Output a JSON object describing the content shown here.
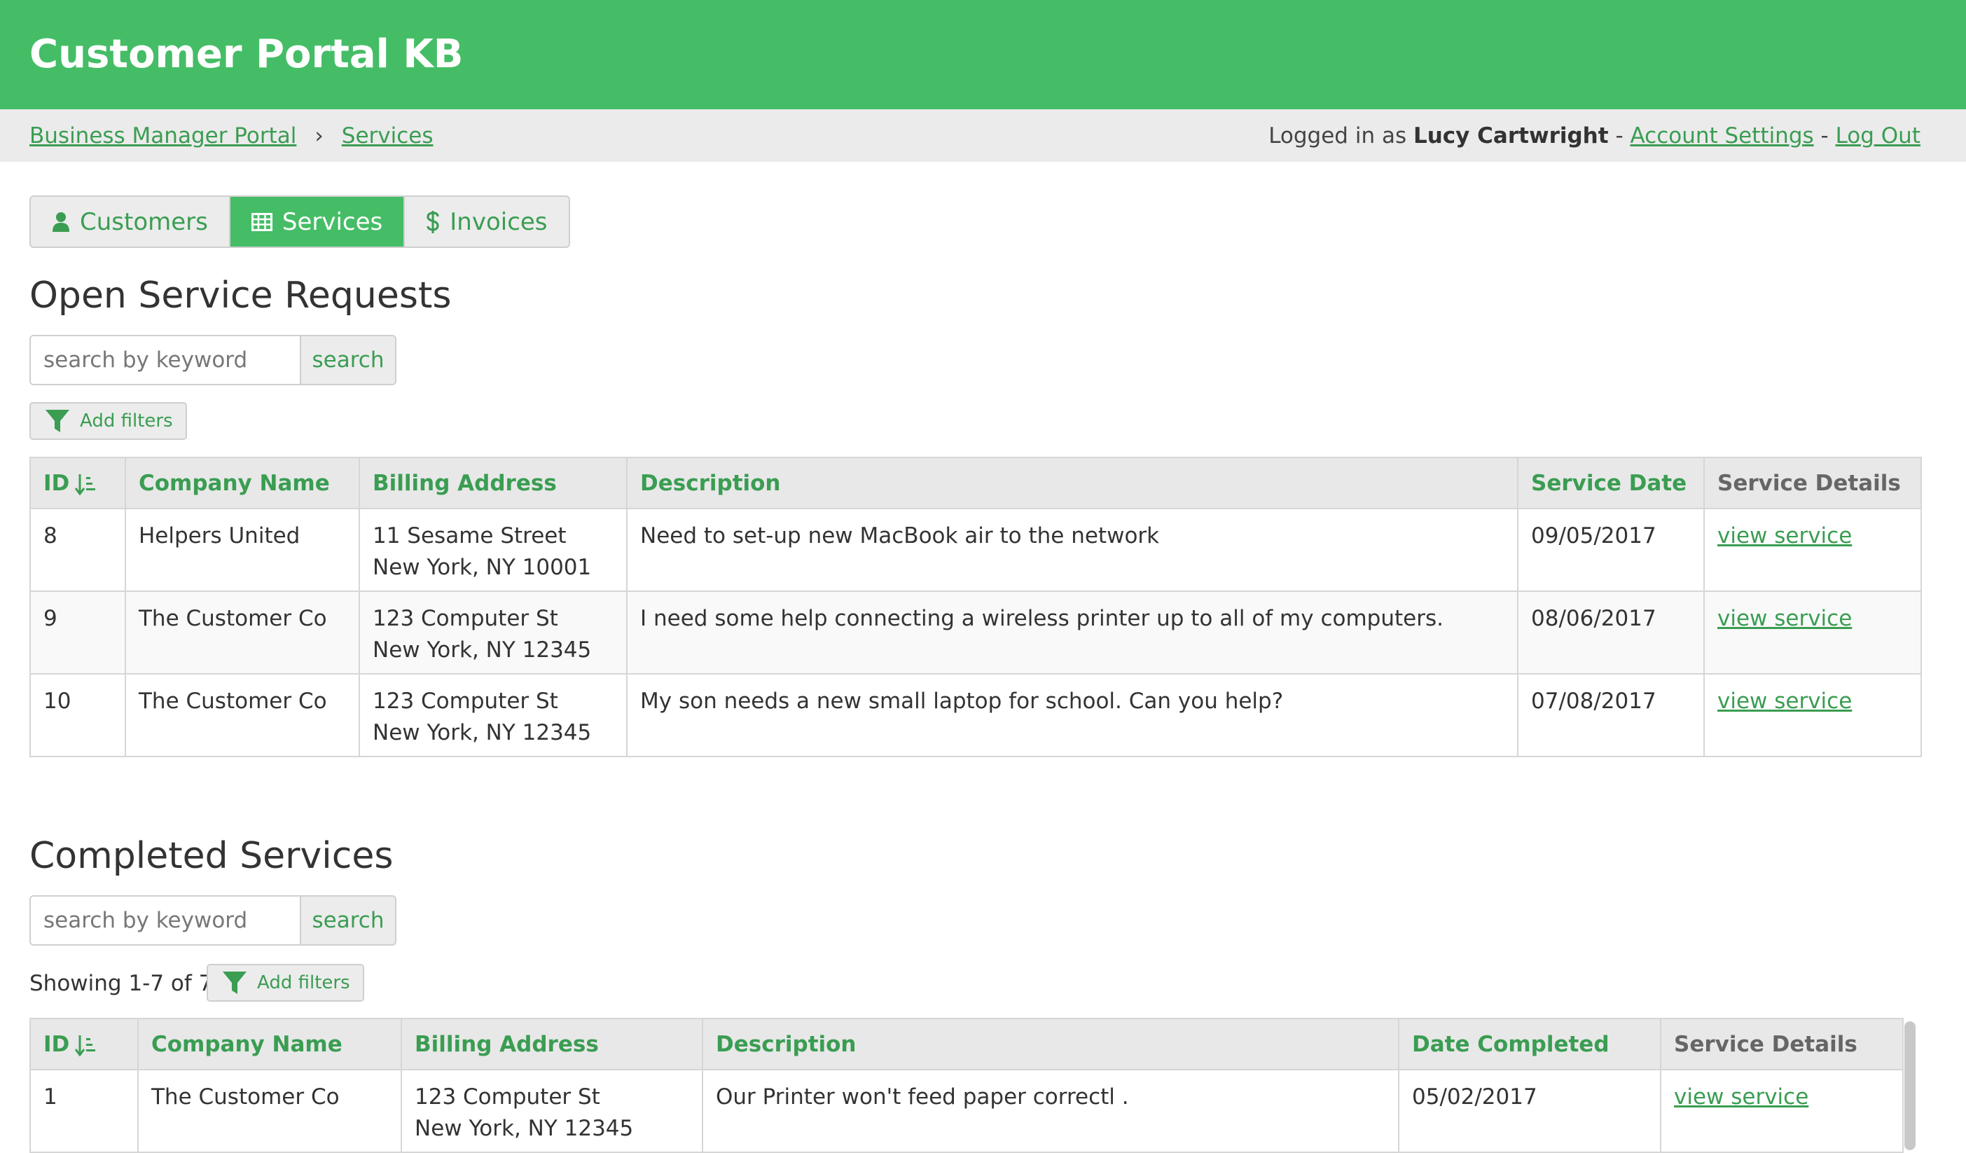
{
  "header": {
    "title": "Customer Portal KB"
  },
  "breadcrumb": {
    "items": [
      "Business Manager Portal",
      "Services"
    ],
    "separator": "›"
  },
  "user": {
    "prefix": "Logged in as",
    "name": "Lucy Cartwright",
    "dash": "-",
    "account_settings": "Account Settings",
    "logout": "Log Out"
  },
  "tabs": [
    {
      "label": "Customers",
      "icon": "user-icon"
    },
    {
      "label": "Services",
      "icon": "table-icon",
      "active": true
    },
    {
      "label": "Invoices",
      "icon": "dollar-icon"
    }
  ],
  "open_section": {
    "title": "Open Service Requests",
    "search_placeholder": "search by keyword",
    "search_label": "search",
    "filter_label": "Add filters",
    "columns": [
      "ID",
      "Company Name",
      "Billing Address",
      "Description",
      "Service Date",
      "Service Details"
    ],
    "rows": [
      {
        "id": "8",
        "company": "Helpers United",
        "address1": "11 Sesame Street",
        "address2": "New York, NY 10001",
        "description": "Need to set-up new MacBook air to the network",
        "date": "09/05/2017",
        "link": "view service"
      },
      {
        "id": "9",
        "company": "The Customer Co",
        "address1": "123 Computer St",
        "address2": "New York, NY 12345",
        "description": "I need some help connecting a wireless printer up to all of my computers.",
        "date": "08/06/2017",
        "link": "view service"
      },
      {
        "id": "10",
        "company": "The Customer Co",
        "address1": "123 Computer St",
        "address2": "New York, NY 12345",
        "description": "My son needs a new small laptop for school. Can you help?",
        "date": "07/08/2017",
        "link": "view service"
      }
    ]
  },
  "completed_section": {
    "title": "Completed Services",
    "search_placeholder": "search by keyword",
    "search_label": "search",
    "showing": "Showing 1-7 of 7",
    "filter_label": "Add filters",
    "columns": [
      "ID",
      "Company Name",
      "Billing Address",
      "Description",
      "Date Completed",
      "Service Details"
    ],
    "rows": [
      {
        "id": "1",
        "company": "The Customer Co",
        "address1": "123 Computer St",
        "address2": "New York, NY 12345",
        "description": "Our Printer won't feed paper correctl .",
        "date": "05/02/2017",
        "link": "view service"
      }
    ]
  },
  "colors": {
    "brand": "#45bd66",
    "link": "#3a9d52"
  }
}
